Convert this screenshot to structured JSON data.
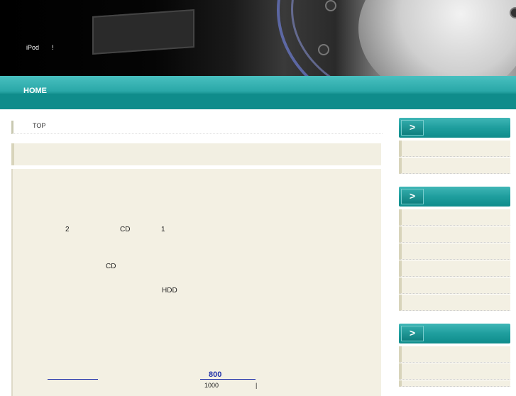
{
  "header": {
    "tagline": "iPod　　!"
  },
  "nav": {
    "home_label": "HOME"
  },
  "breadcrumb": {
    "top_label": "TOP"
  },
  "content": {
    "line1_num_a": "2",
    "line1_cd": "CD",
    "line1_num_b": "1",
    "line2_cd": "CD",
    "line3_hdd": "HDD",
    "link_800": "800",
    "line_1000": "1000",
    "line_pipe": "|"
  },
  "sidebar": {
    "arrow_symbol": ">",
    "sections": [
      {
        "item_count": 2
      },
      {
        "item_count": 6
      },
      {
        "item_count": 3
      }
    ]
  },
  "colors": {
    "nav_teal": "#1f9e9e",
    "content_bg": "#f3f0e3",
    "link_blue": "#2233aa"
  }
}
